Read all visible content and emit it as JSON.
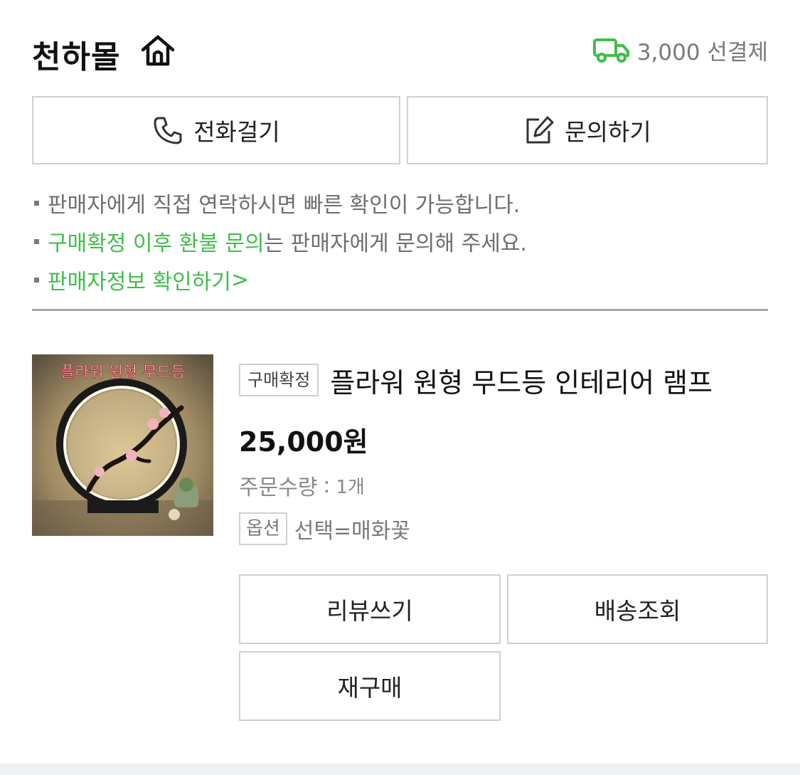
{
  "header": {
    "store_name": "천하몰",
    "home_icon": "home-icon",
    "shipping_icon": "truck-icon",
    "shipping_text": "3,000 선결제",
    "shipping_icon_color": "#3fbe4a"
  },
  "actions": {
    "call_label": "전화걸기",
    "call_icon": "phone-icon",
    "inquiry_label": "문의하기",
    "inquiry_icon": "edit-icon"
  },
  "notices": {
    "line1": "판매자에게 직접 연락하시면 빠른 확인이 가능합니다.",
    "line2_highlight": "구매확정 이후 환불 문의",
    "line2_rest": "는 판매자에게 문의해 주세요.",
    "line3_link": "판매자정보 확인하기",
    "line3_chevron": ">",
    "accent_color": "#3fbe4a"
  },
  "product": {
    "image_alt": "플라워 원형 무드등",
    "status_badge": "구매확정",
    "title": "플라워 원형 무드등 인테리어 램프",
    "price": "25,000원",
    "quantity_label": "주문수량",
    "quantity_sep": ":",
    "quantity_value": "1개",
    "option_badge": "옵션",
    "option_value": "선택=매화꽃"
  },
  "order_actions": {
    "review_label": "리뷰쓰기",
    "track_label": "배송조회",
    "rebuy_label": "재구매"
  }
}
